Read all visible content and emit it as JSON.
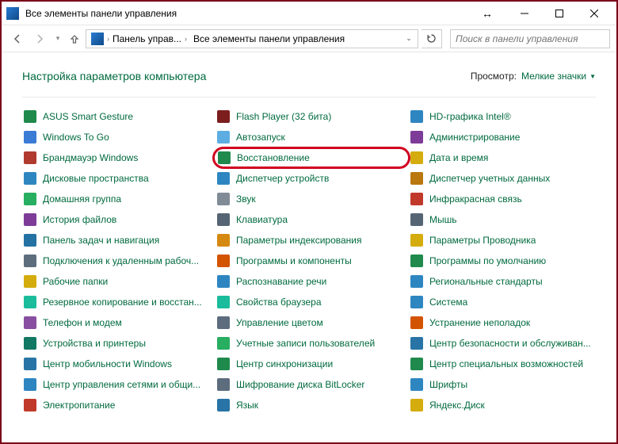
{
  "window": {
    "title": "Все элементы панели управления"
  },
  "breadcrumb": {
    "part1": "Панель управ...",
    "part2": "Все элементы панели управления"
  },
  "search": {
    "placeholder": "Поиск в панели управления"
  },
  "header": {
    "title": "Настройка параметров компьютера",
    "view_label": "Просмотр:",
    "view_value": "Мелкие значки"
  },
  "items": {
    "c0": [
      "ASUS Smart Gesture",
      "Windows To Go",
      "Брандмауэр Windows",
      "Дисковые пространства",
      "Домашняя группа",
      "История файлов",
      "Панель задач и навигация",
      "Подключения к удаленным рабоч...",
      "Рабочие папки",
      "Резервное копирование и восстан...",
      "Телефон и модем",
      "Устройства и принтеры",
      "Центр мобильности Windows",
      "Центр управления сетями и общи...",
      "Электропитание"
    ],
    "c1": [
      "Flash Player (32 бита)",
      "Автозапуск",
      "Восстановление",
      "Диспетчер устройств",
      "Звук",
      "Клавиатура",
      "Параметры индексирования",
      "Программы и компоненты",
      "Распознавание речи",
      "Свойства браузера",
      "Управление цветом",
      "Учетные записи пользователей",
      "Центр синхронизации",
      "Шифрование диска BitLocker",
      "Язык"
    ],
    "c2": [
      "HD-графика Intel®",
      "Администрирование",
      "Дата и время",
      "Диспетчер учетных данных",
      "Инфракрасная связь",
      "Мышь",
      "Параметры Проводника",
      "Программы по умолчанию",
      "Региональные стандарты",
      "Система",
      "Устранение неполадок",
      "Центр безопасности и обслуживан...",
      "Центр специальных возможностей",
      "Шрифты",
      "Яндекс.Диск"
    ]
  },
  "icon_colors": {
    "c0": [
      "#1f8a4c",
      "#3a7bd5",
      "#b03a2e",
      "#2e86c1",
      "#27ae60",
      "#7d3c98",
      "#2471a3",
      "#5d6d7e",
      "#d4ac0d",
      "#1abc9c",
      "#884ea0",
      "#117864",
      "#2874a6",
      "#2e86c1",
      "#c0392b"
    ],
    "c1": [
      "#7d1e1e",
      "#5dade2",
      "#1f8a4c",
      "#2e86c1",
      "#808b96",
      "#566573",
      "#d68910",
      "#d35400",
      "#2e86c1",
      "#1abc9c",
      "#5d6d7e",
      "#27ae60",
      "#1f8a4c",
      "#5d6d7e",
      "#2874a6"
    ],
    "c2": [
      "#2e86c1",
      "#7d3c98",
      "#d4ac0d",
      "#b9770e",
      "#c0392b",
      "#566573",
      "#d4ac0d",
      "#1f8a4c",
      "#2e86c1",
      "#2e86c1",
      "#d35400",
      "#2874a6",
      "#1f8a4c",
      "#2e86c1",
      "#d4ac0d"
    ]
  },
  "highlight": {
    "col": "c1",
    "row": 2
  }
}
